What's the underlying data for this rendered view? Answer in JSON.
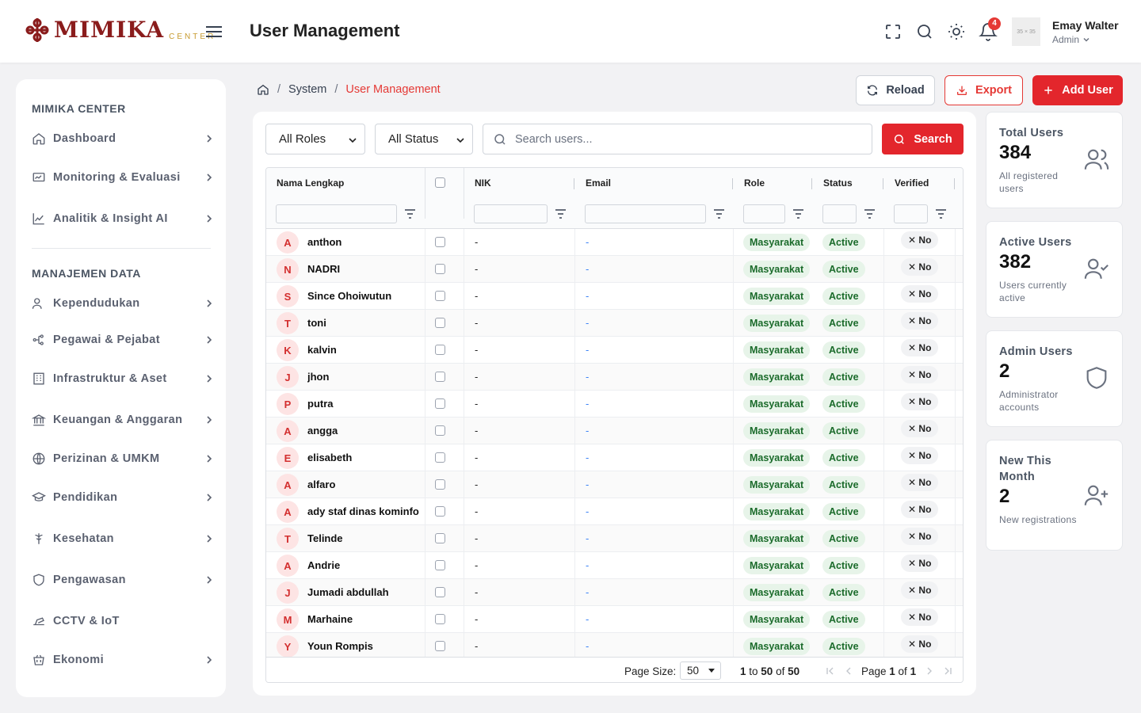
{
  "brand": {
    "name": "MIMIKA",
    "sub": "CENTER",
    "color": "#8a1c1c",
    "accent": "#c79a2e"
  },
  "header": {
    "title": "User Management",
    "notification_count": "4",
    "avatar_placeholder": "35 × 35",
    "user_name": "Emay Walter",
    "user_role": "Admin"
  },
  "sidebar": {
    "section1": "MIMIKA CENTER",
    "section2": "MANAJEMEN DATA",
    "items": [
      {
        "label": "Dashboard",
        "icon": "home-icon"
      },
      {
        "label": "Monitoring & Evaluasi",
        "icon": "monitor-icon"
      },
      {
        "label": "Analitik & Insight AI",
        "icon": "chart-icon"
      },
      {
        "label": "Kependudukan",
        "icon": "people-icon"
      },
      {
        "label": "Pegawai & Pejabat",
        "icon": "org-icon"
      },
      {
        "label": "Infrastruktur & Aset",
        "icon": "building-icon"
      },
      {
        "label": "Keuangan & Anggaran",
        "icon": "bank-icon"
      },
      {
        "label": "Perizinan & UMKM",
        "icon": "globe-icon"
      },
      {
        "label": "Pendidikan",
        "icon": "graduation-icon"
      },
      {
        "label": "Kesehatan",
        "icon": "health-icon"
      },
      {
        "label": "Pengawasan",
        "icon": "shield-icon"
      },
      {
        "label": "CCTV & IoT",
        "icon": "camera-icon"
      },
      {
        "label": "Ekonomi",
        "icon": "basket-icon"
      }
    ]
  },
  "breadcrumb": {
    "home": "home-icon",
    "system": "System",
    "current": "User Management"
  },
  "actions": {
    "reload": "Reload",
    "export": "Export",
    "add": "Add User"
  },
  "filters": {
    "roles": "All Roles",
    "status": "All Status",
    "search_placeholder": "Search users...",
    "search_button": "Search"
  },
  "table": {
    "columns": [
      "Nama Lengkap",
      "NIK",
      "Email",
      "Role",
      "Status",
      "Verified"
    ],
    "rows": [
      {
        "initial": "A",
        "name": "anthon",
        "nik": "-",
        "email": "-",
        "role": "Masyarakat",
        "status": "Active",
        "verified": "No"
      },
      {
        "initial": "N",
        "name": "NADRI",
        "nik": "-",
        "email": "-",
        "role": "Masyarakat",
        "status": "Active",
        "verified": "No"
      },
      {
        "initial": "S",
        "name": "Since Ohoiwutun",
        "nik": "-",
        "email": "-",
        "role": "Masyarakat",
        "status": "Active",
        "verified": "No"
      },
      {
        "initial": "T",
        "name": "toni",
        "nik": "-",
        "email": "-",
        "role": "Masyarakat",
        "status": "Active",
        "verified": "No"
      },
      {
        "initial": "K",
        "name": "kalvin",
        "nik": "-",
        "email": "-",
        "role": "Masyarakat",
        "status": "Active",
        "verified": "No"
      },
      {
        "initial": "J",
        "name": "jhon",
        "nik": "-",
        "email": "-",
        "role": "Masyarakat",
        "status": "Active",
        "verified": "No"
      },
      {
        "initial": "P",
        "name": "putra",
        "nik": "-",
        "email": "-",
        "role": "Masyarakat",
        "status": "Active",
        "verified": "No"
      },
      {
        "initial": "A",
        "name": "angga",
        "nik": "-",
        "email": "-",
        "role": "Masyarakat",
        "status": "Active",
        "verified": "No"
      },
      {
        "initial": "E",
        "name": "elisabeth",
        "nik": "-",
        "email": "-",
        "role": "Masyarakat",
        "status": "Active",
        "verified": "No"
      },
      {
        "initial": "A",
        "name": "alfaro",
        "nik": "-",
        "email": "-",
        "role": "Masyarakat",
        "status": "Active",
        "verified": "No"
      },
      {
        "initial": "A",
        "name": "ady staf dinas kominfo",
        "nik": "-",
        "email": "-",
        "role": "Masyarakat",
        "status": "Active",
        "verified": "No"
      },
      {
        "initial": "T",
        "name": "Telinde",
        "nik": "-",
        "email": "-",
        "role": "Masyarakat",
        "status": "Active",
        "verified": "No"
      },
      {
        "initial": "A",
        "name": "Andrie",
        "nik": "-",
        "email": "-",
        "role": "Masyarakat",
        "status": "Active",
        "verified": "No"
      },
      {
        "initial": "J",
        "name": "Jumadi abdullah",
        "nik": "-",
        "email": "-",
        "role": "Masyarakat",
        "status": "Active",
        "verified": "No"
      },
      {
        "initial": "M",
        "name": "Marhaine",
        "nik": "-",
        "email": "-",
        "role": "Masyarakat",
        "status": "Active",
        "verified": "No"
      },
      {
        "initial": "Y",
        "name": "Youn Rompis",
        "nik": "-",
        "email": "-",
        "role": "Masyarakat",
        "status": "Active",
        "verified": "No"
      }
    ]
  },
  "pagination": {
    "page_size_label": "Page Size:",
    "page_size": "50",
    "from": "1",
    "to": "50",
    "total": "50",
    "page": "1",
    "pages": "1"
  },
  "stats": [
    {
      "title": "Total Users",
      "value": "384",
      "sub": "All registered users",
      "icon": "users-icon"
    },
    {
      "title": "Active Users",
      "value": "382",
      "sub": "Users currently active",
      "icon": "user-check-icon"
    },
    {
      "title": "Admin Users",
      "value": "2",
      "sub": "Administrator accounts",
      "icon": "shield-icon"
    },
    {
      "title": "New This Month",
      "value": "2",
      "sub": "New registrations",
      "icon": "user-plus-icon"
    }
  ],
  "colors": {
    "primary": "#e3262c",
    "active_bg": "#e7f4e9",
    "active_text": "#1b6b2b"
  }
}
